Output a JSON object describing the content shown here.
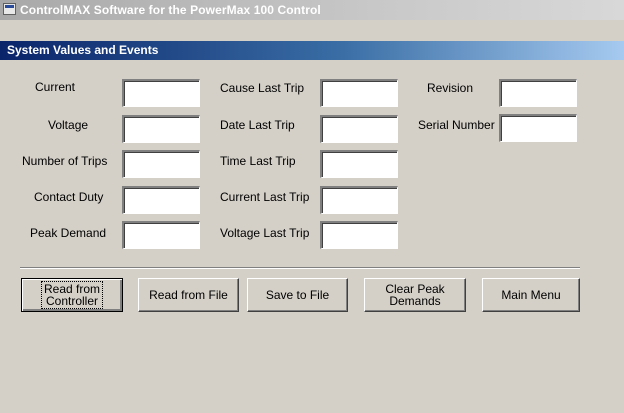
{
  "window": {
    "title": "ControlMAX Software for the PowerMax 100 Control"
  },
  "form": {
    "title": "System Values and Events"
  },
  "fields": {
    "current": {
      "label": "Current",
      "value": ""
    },
    "voltage": {
      "label": "Voltage",
      "value": ""
    },
    "number_of_trips": {
      "label": "Number of Trips",
      "value": ""
    },
    "contact_duty": {
      "label": "Contact Duty",
      "value": ""
    },
    "peak_demand": {
      "label": "Peak Demand",
      "value": ""
    },
    "cause_last_trip": {
      "label": "Cause Last Trip",
      "value": ""
    },
    "date_last_trip": {
      "label": "Date Last Trip",
      "value": ""
    },
    "time_last_trip": {
      "label": "Time Last Trip",
      "value": ""
    },
    "current_last_trip": {
      "label": "Current Last Trip",
      "value": ""
    },
    "voltage_last_trip": {
      "label": "Voltage Last Trip",
      "value": ""
    },
    "revision": {
      "label": "Revision",
      "value": ""
    },
    "serial_number": {
      "label": "Serial Number",
      "value": ""
    }
  },
  "buttons": {
    "read_controller": {
      "line1": "Read from",
      "line2": "Controller"
    },
    "read_file": "Read from File",
    "save_file": "Save to File",
    "clear_peak": {
      "line1": "Clear Peak",
      "line2": "Demands"
    },
    "main_menu": "Main Menu"
  },
  "colors": {
    "face": "#d4d0c8",
    "active_caption_start": "#0a246a",
    "active_caption_end": "#a6caf0",
    "inactive_caption": "#a8a8a8"
  }
}
